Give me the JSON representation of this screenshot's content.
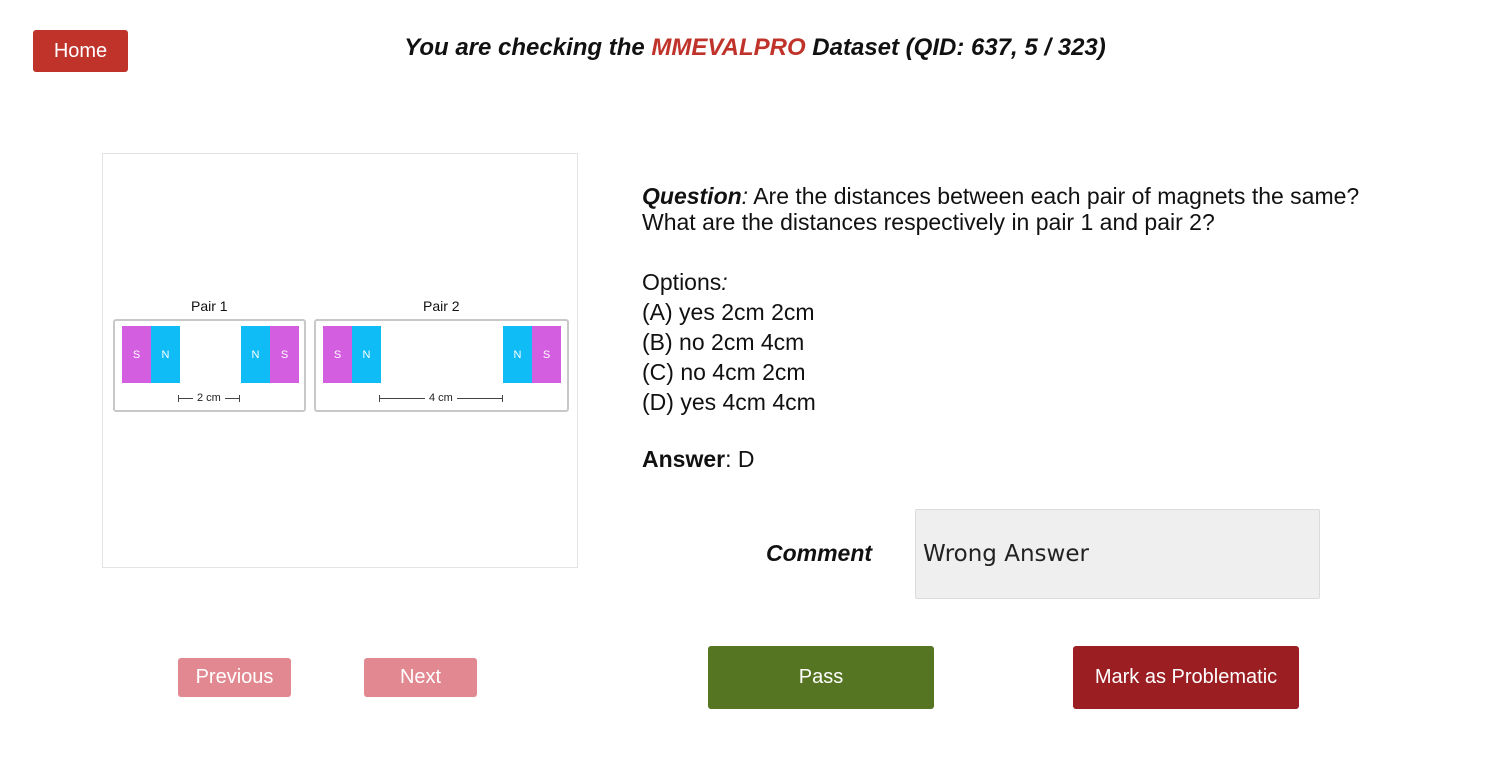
{
  "header": {
    "home_label": "Home",
    "title_prefix": "You are checking the ",
    "dataset_name": "MMEVALPRO",
    "title_suffix": " Dataset (QID: 637, 5 / 323)",
    "accent_color": "#c0332b"
  },
  "figure": {
    "pairs": [
      {
        "label": "Pair 1",
        "poles": [
          "S",
          "N",
          "N",
          "S"
        ],
        "distance": "2 cm"
      },
      {
        "label": "Pair 2",
        "poles": [
          "S",
          "N",
          "N",
          "S"
        ],
        "distance": "4 cm"
      }
    ],
    "colors": {
      "south": "#d45ee0",
      "north": "#0fbcf5"
    }
  },
  "question": {
    "label": "Question",
    "text": "Are the distances between each pair of magnets the same? What are the distances respectively in pair 1 and pair 2?"
  },
  "options": {
    "label": "Options",
    "items": [
      "(A) yes 2cm 2cm",
      "(B) no 2cm 4cm",
      "(C) no 4cm 2cm",
      "(D) yes 4cm 4cm"
    ]
  },
  "answer": {
    "label": "Answer",
    "value": "D"
  },
  "comment": {
    "label": "Comment",
    "value": "Wrong Answer"
  },
  "nav": {
    "previous_label": "Previous",
    "next_label": "Next"
  },
  "actions": {
    "pass_label": "Pass",
    "problem_label": "Mark as Problematic"
  }
}
